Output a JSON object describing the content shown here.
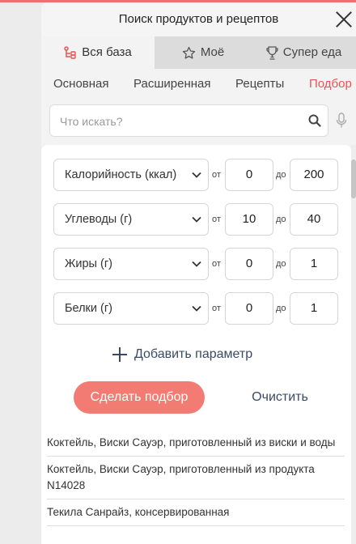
{
  "dialog": {
    "title": "Поиск продуктов и рецептов"
  },
  "tabs": [
    {
      "label": "Вся база",
      "icon": "tree-icon",
      "active": true
    },
    {
      "label": "Моё",
      "icon": "star-icon",
      "active": false
    },
    {
      "label": "Супер еда",
      "icon": "trophy-icon",
      "active": false
    }
  ],
  "subtabs": [
    {
      "label": "Основная"
    },
    {
      "label": "Расширенная"
    },
    {
      "label": "Рецепты"
    },
    {
      "label": "Подбор",
      "active": true
    }
  ],
  "search": {
    "placeholder": "Что искать?",
    "value": ""
  },
  "filters": {
    "from_label": "от",
    "to_label": "до",
    "rows": [
      {
        "param": "Калорийность (ккал)",
        "from": "0",
        "to": "200"
      },
      {
        "param": "Углеводы (г)",
        "from": "10",
        "to": "40"
      },
      {
        "param": "Жиры (г)",
        "from": "0",
        "to": "1"
      },
      {
        "param": "Белки (г)",
        "from": "0",
        "to": "1"
      }
    ],
    "add_label": "Добавить параметр"
  },
  "actions": {
    "submit_label": "Сделать подбор",
    "clear_label": "Очистить"
  },
  "results": [
    "Коктейль, Виски Сауэр, приготовленный из виски и воды",
    "Коктейль, Виски Сауэр, приготовленный из продукта N14028",
    "Текила Санрайз, консервированная"
  ],
  "colors": {
    "accent": "#ef5350",
    "button": "#f27c73",
    "link": "#3a4a66"
  }
}
